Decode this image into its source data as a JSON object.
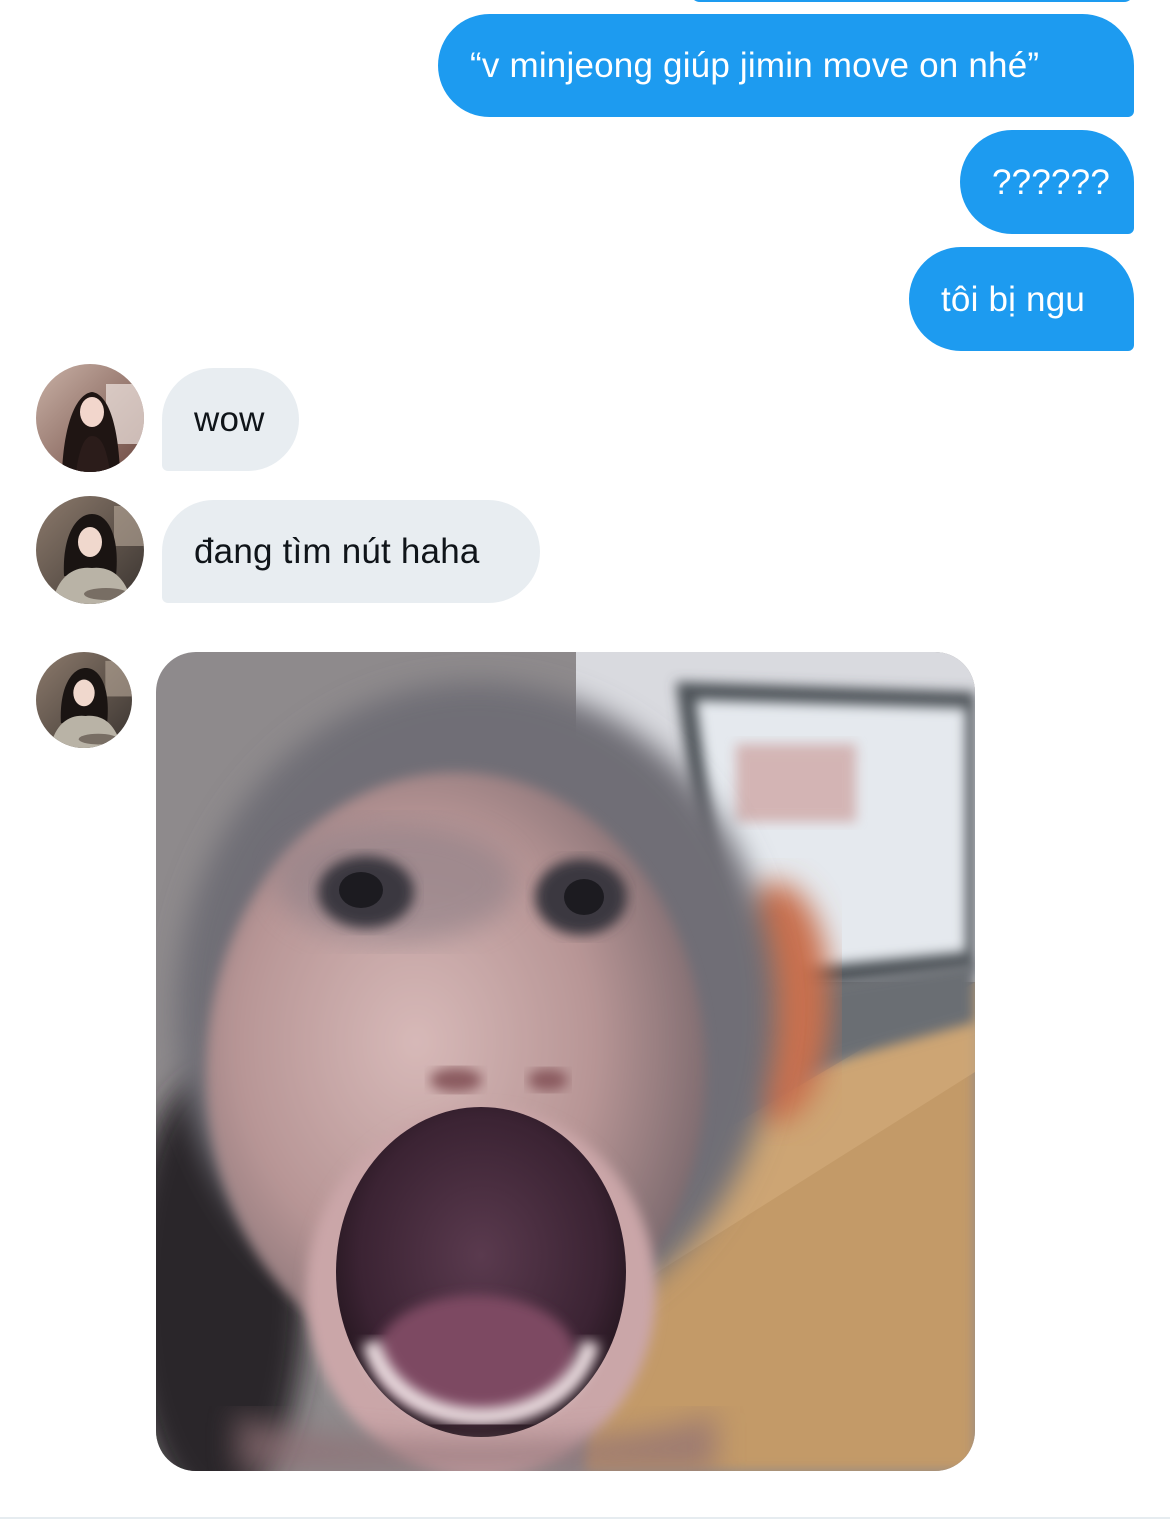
{
  "conversation": {
    "messages": [
      {
        "direction": "sent",
        "text": "“v minjeong giúp jimin move on nhé”"
      },
      {
        "direction": "sent",
        "text": "??????"
      },
      {
        "direction": "sent",
        "text": "tôi bị ngu"
      },
      {
        "direction": "received",
        "text": "wow",
        "avatar": "avatar-photo"
      },
      {
        "direction": "received",
        "text": "đang tìm nút haha",
        "avatar": "avatar-photo"
      },
      {
        "direction": "received",
        "media": "shouting-monkey-gif",
        "avatar": "avatar-photo"
      }
    ]
  },
  "colors": {
    "sent_bubble": "#1d9bf0",
    "received_bubble": "#e8edf1",
    "sent_text": "#ffffff",
    "received_text": "#0f1419",
    "background": "#ffffff"
  }
}
